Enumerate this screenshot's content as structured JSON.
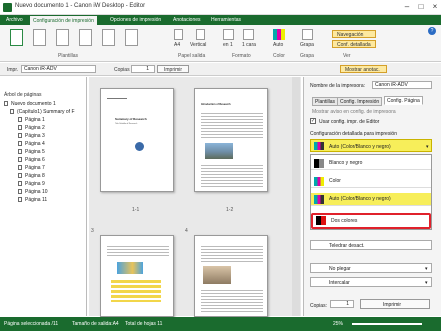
{
  "window": {
    "title": "Nuevo documento 1 - Canon iW Desktop - Editor",
    "min": "–",
    "max": "□",
    "close": "×"
  },
  "menu": [
    "Archivo",
    "Configuración de impresión",
    "Opciones de impresión",
    "Anotaciones",
    "Herramientas"
  ],
  "ribbon": {
    "groups": [
      "Plantillas",
      "Papel salida",
      "Formato",
      "Color",
      "Grapa",
      "Ver"
    ],
    "papel": {
      "size": "A4",
      "orientation": "Vertical"
    },
    "formato": {
      "layout": "en 1",
      "sides": "1 cara"
    },
    "color": {
      "value": "Auto"
    },
    "grapa": {
      "value": "Grapa"
    },
    "ver": {
      "nav": "Navegación",
      "detail": "Conf. detallada"
    }
  },
  "toolbar": {
    "impr_label": "Impr.",
    "printer": "Canon iR-ADV",
    "copies_label": "Copias",
    "copies": "1",
    "print": "Imprimir",
    "show_annot": "Mostrar anotac."
  },
  "tree": {
    "header": "Árbol de páginas",
    "items": [
      "Nuevo documento 1",
      "(Capítulo1) Summary of F",
      "Página 1",
      "Página 2",
      "Página 3",
      "Página 4",
      "Página 5",
      "Página 6",
      "Página 7",
      "Página 8",
      "Página 9",
      "Página 10",
      "Página 11"
    ]
  },
  "pages": {
    "labels": [
      "1-1",
      "1-2",
      "3",
      "4"
    ],
    "p1_title": "Summary of Research",
    "p1_sub": "Title Subtitle of Research",
    "p2_title": "Introduction of Research",
    "p3_title": "",
    "p4_title": ""
  },
  "right": {
    "printer_label": "Nombre de la impresora:",
    "printer": "Canon iR-ADV",
    "tabs": [
      "Plantillas",
      "Config. Impresión",
      "Config. Página"
    ],
    "notice": "Mostrar aviso en config. de impresora",
    "use_config": "Usar config. impr. de Editor",
    "detail_label": "Configuración detallada para impresión",
    "color_selected": "Auto (Color/Blanco y negro)",
    "options": [
      "Blanco y negro",
      "Color",
      "Auto (Color/Blanco y negro)",
      "Dos colores"
    ],
    "staple": "Teledrar desact.",
    "fold": "No plegar",
    "insert": "Intercalar",
    "copies_label": "Copias:",
    "copies": "1",
    "print": "Imprimir"
  },
  "status": {
    "selected": "Página seleccionada /11",
    "size": "Tamaño de salida:A4",
    "total": "Total de hojas 11",
    "zoom": "25%"
  },
  "colors": {
    "green": "#1a6b2e",
    "highlight": "#f7ee5a",
    "redbox": "#e0212b"
  }
}
